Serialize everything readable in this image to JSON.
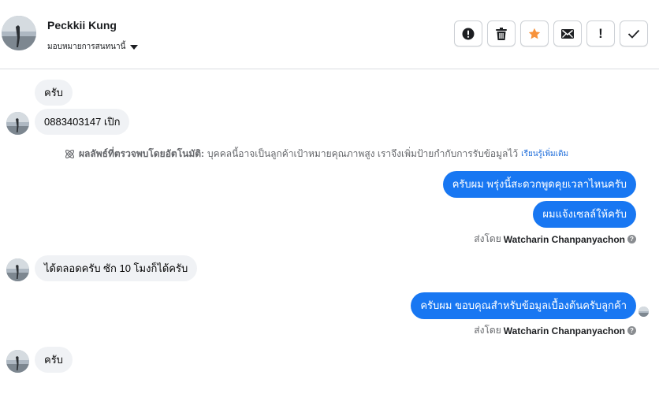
{
  "contact": {
    "name": "Peckkii Kung",
    "assign_label": "มอบหมายการสนทนานี้"
  },
  "actions": {
    "spam_icon": "alert-circle-icon",
    "delete_icon": "trash-icon",
    "star_icon": "star-icon",
    "mail_icon": "envelope-icon",
    "follow_up_label": "!",
    "done_icon": "check-icon",
    "star_color": "#f7923b"
  },
  "messages": [
    {
      "side": "in",
      "text": "ครับ"
    },
    {
      "side": "in",
      "text": "0883403147  เปิก"
    },
    {
      "side": "notice",
      "title": "ผลลัพธ์ที่ตรวจพบโดยอัตโนมัติ:",
      "body": "บุคคลนี้อาจเป็นลูกค้าเป้าหมายคุณภาพสูง เราจึงเพิ่มป้ายกำกับการรับข้อมูลไว้",
      "link": "เรียนรู้เพิ่มเติม"
    },
    {
      "side": "out",
      "text": "ครับผม พรุ่งนี้สะดวกพูดคุยเวลาไหนครับ"
    },
    {
      "side": "out",
      "text": "ผมแจ้งเซลล์ให้ครับ"
    },
    {
      "side": "sentby",
      "prefix": "ส่งโดย",
      "name": "Watcharin Chanpanyachon"
    },
    {
      "side": "in",
      "text": "ได้ตลอดครับ ซัก 10 โมงก็ได้ครับ"
    },
    {
      "side": "out",
      "text": "ครับผม ขอบคุณสำหรับข้อมูลเบื้องต้นครับลูกค้า"
    },
    {
      "side": "sentby",
      "prefix": "ส่งโดย",
      "name": "Watcharin Chanpanyachon"
    },
    {
      "side": "in",
      "text": "ครับ"
    }
  ],
  "colors": {
    "outgoing_bubble": "#1877f2",
    "incoming_bubble": "#f0f2f5",
    "link": "#216fdb"
  }
}
